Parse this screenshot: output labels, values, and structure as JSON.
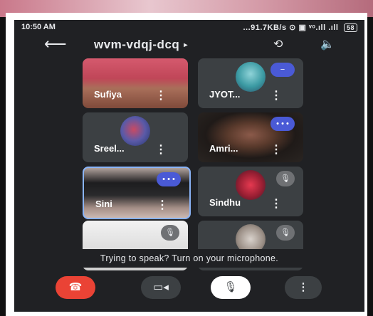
{
  "status": {
    "time": "10:50 AM",
    "speed": "...91.7KB/s",
    "signal": "⊙ ▣ ᵛᵒ.ıll .ıll",
    "battery": "58"
  },
  "header": {
    "meeting_code": "wvm-vdqj-dcq",
    "caret": "▸",
    "back": "⟵",
    "switch_camera": "⟲",
    "speaker": "🔈"
  },
  "participants": [
    {
      "name": "Sufiya",
      "menu": "⋮"
    },
    {
      "name": "JYOT...",
      "menu": "⋮",
      "status": "−"
    },
    {
      "name": "Sreel...",
      "menu": "⋮"
    },
    {
      "name": "Amri...",
      "menu": "⋮",
      "status": "• • •"
    },
    {
      "name": "Sini",
      "menu": "⋮",
      "status": "• • •"
    },
    {
      "name": "Sindhu",
      "menu": "⋮",
      "status": "🎙"
    },
    {
      "name": "",
      "status": "🎙"
    },
    {
      "name": "",
      "status": "🎙"
    }
  ],
  "message": "Trying to speak? Turn on your microphone.",
  "controls": {
    "end_call": "☎",
    "camera": "▭◂",
    "mic": "🎙",
    "more": "⋮"
  },
  "colors": {
    "background": "#202124",
    "tile": "#3c4043",
    "end_call": "#ea4335",
    "accent": "#4a5ad6"
  }
}
